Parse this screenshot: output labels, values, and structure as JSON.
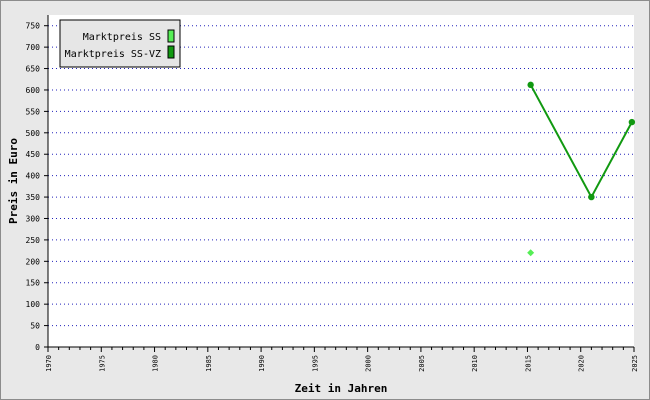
{
  "chart_data": {
    "type": "line",
    "title": "",
    "xlabel": "Zeit in Jahren",
    "ylabel": "Preis in Euro",
    "xlim": [
      1970,
      2025
    ],
    "ylim": [
      0,
      775
    ],
    "x_ticks": [
      1970,
      1975,
      1980,
      1985,
      1990,
      1995,
      2000,
      2005,
      2010,
      2015,
      2020,
      2025
    ],
    "y_ticks": [
      0,
      50,
      100,
      150,
      200,
      250,
      300,
      350,
      400,
      450,
      500,
      550,
      600,
      650,
      700,
      750
    ],
    "grid": "horizontal dotted",
    "legend_position": "top-left",
    "series": [
      {
        "name": "Marktpreis SS",
        "color": "#55ee55",
        "marker": "diamond",
        "x": [
          2015.3
        ],
        "y": [
          220
        ]
      },
      {
        "name": "Marktpreis SS-VZ",
        "color": "#119911",
        "marker": "circle",
        "x": [
          2015.3,
          2021.0,
          2024.8
        ],
        "y": [
          612,
          350,
          525
        ]
      }
    ]
  }
}
